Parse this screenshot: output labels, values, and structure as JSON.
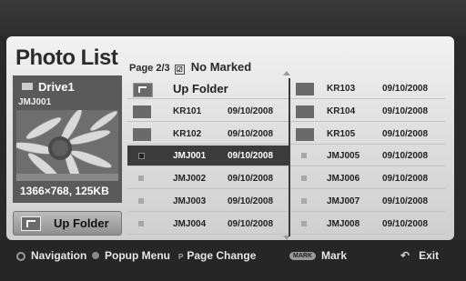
{
  "title": "Photo List",
  "page_info": {
    "page": "Page 2/3",
    "checkbox_symbol": "☑",
    "mark_status": "No Marked"
  },
  "preview": {
    "drive": "Drive1",
    "filename": "JMJ001",
    "resolution": "1366×768, 125KB",
    "up_folder_button": "Up Folder"
  },
  "left_column": [
    {
      "type": "upfolder",
      "name": "Up Folder",
      "date": ""
    },
    {
      "type": "folder",
      "name": "KR101",
      "date": "09/10/2008"
    },
    {
      "type": "folder",
      "name": "KR102",
      "date": "09/10/2008"
    },
    {
      "type": "photo",
      "name": "JMJ001",
      "date": "09/10/2008",
      "selected": true
    },
    {
      "type": "photo",
      "name": "JMJ002",
      "date": "09/10/2008"
    },
    {
      "type": "photo",
      "name": "JMJ003",
      "date": "09/10/2008"
    },
    {
      "type": "photo",
      "name": "JMJ004",
      "date": "09/10/2008"
    }
  ],
  "right_column": [
    {
      "type": "folder",
      "name": "KR103",
      "date": "09/10/2008"
    },
    {
      "type": "folder",
      "name": "KR104",
      "date": "09/10/2008"
    },
    {
      "type": "folder",
      "name": "KR105",
      "date": "09/10/2008"
    },
    {
      "type": "photo",
      "name": "JMJ005",
      "date": "09/10/2008"
    },
    {
      "type": "photo",
      "name": "JMJ006",
      "date": "09/10/2008"
    },
    {
      "type": "photo",
      "name": "JMJ007",
      "date": "09/10/2008"
    },
    {
      "type": "photo",
      "name": "JMJ008",
      "date": "09/10/2008"
    }
  ],
  "footer": {
    "navigation": "Navigation",
    "popup_menu": "Popup Menu",
    "page_change_icon": "P",
    "page_change": "Page Change",
    "mark_icon": "MARK",
    "mark": "Mark",
    "exit": "Exit"
  },
  "colors": {
    "selected": "#3b3b3b",
    "panel": "#e2e2e2",
    "background": "#2a2a2a"
  }
}
